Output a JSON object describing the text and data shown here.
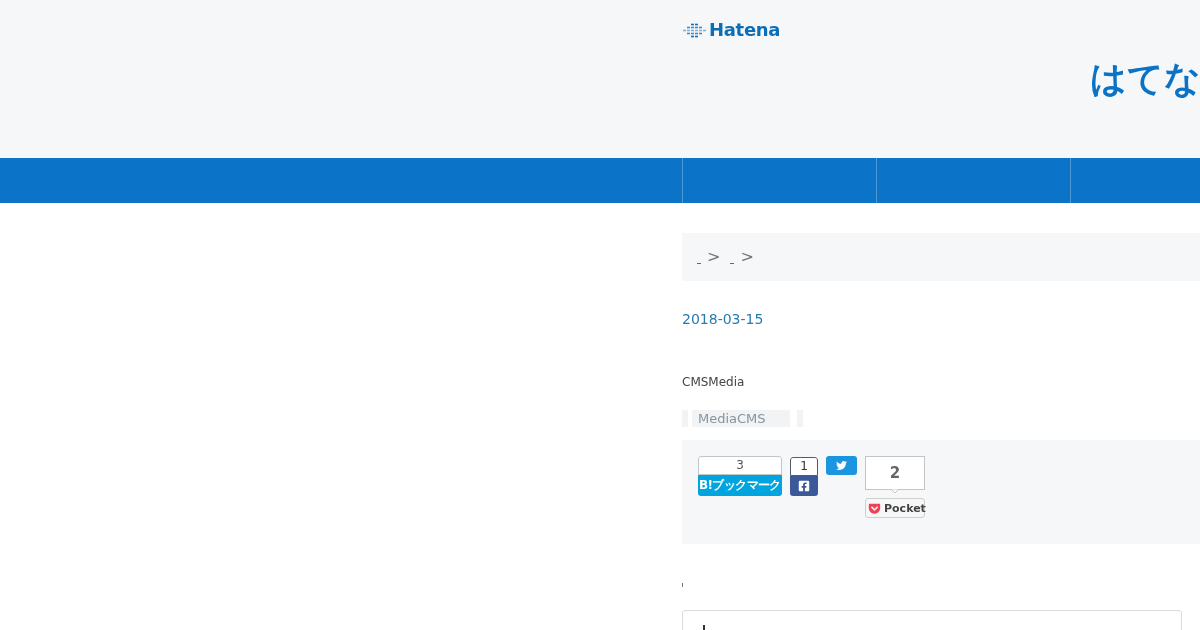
{
  "header": {
    "logo": "Hatena",
    "title": "はてな"
  },
  "breadcrumb": [
    {
      "separator": ">"
    },
    {
      "separator": ">"
    }
  ],
  "date": "2018-03-15",
  "category": "CMSMedia",
  "tags": [
    "MediaCMS"
  ],
  "share_buttons": [
    {
      "kind": "hatena",
      "count": "3",
      "label": "B!ブックマーク"
    },
    {
      "kind": "facebook",
      "count": "1"
    },
    {
      "kind": "twitter"
    },
    {
      "kind": "pocket",
      "count": "2",
      "label": "Pocket"
    }
  ]
}
